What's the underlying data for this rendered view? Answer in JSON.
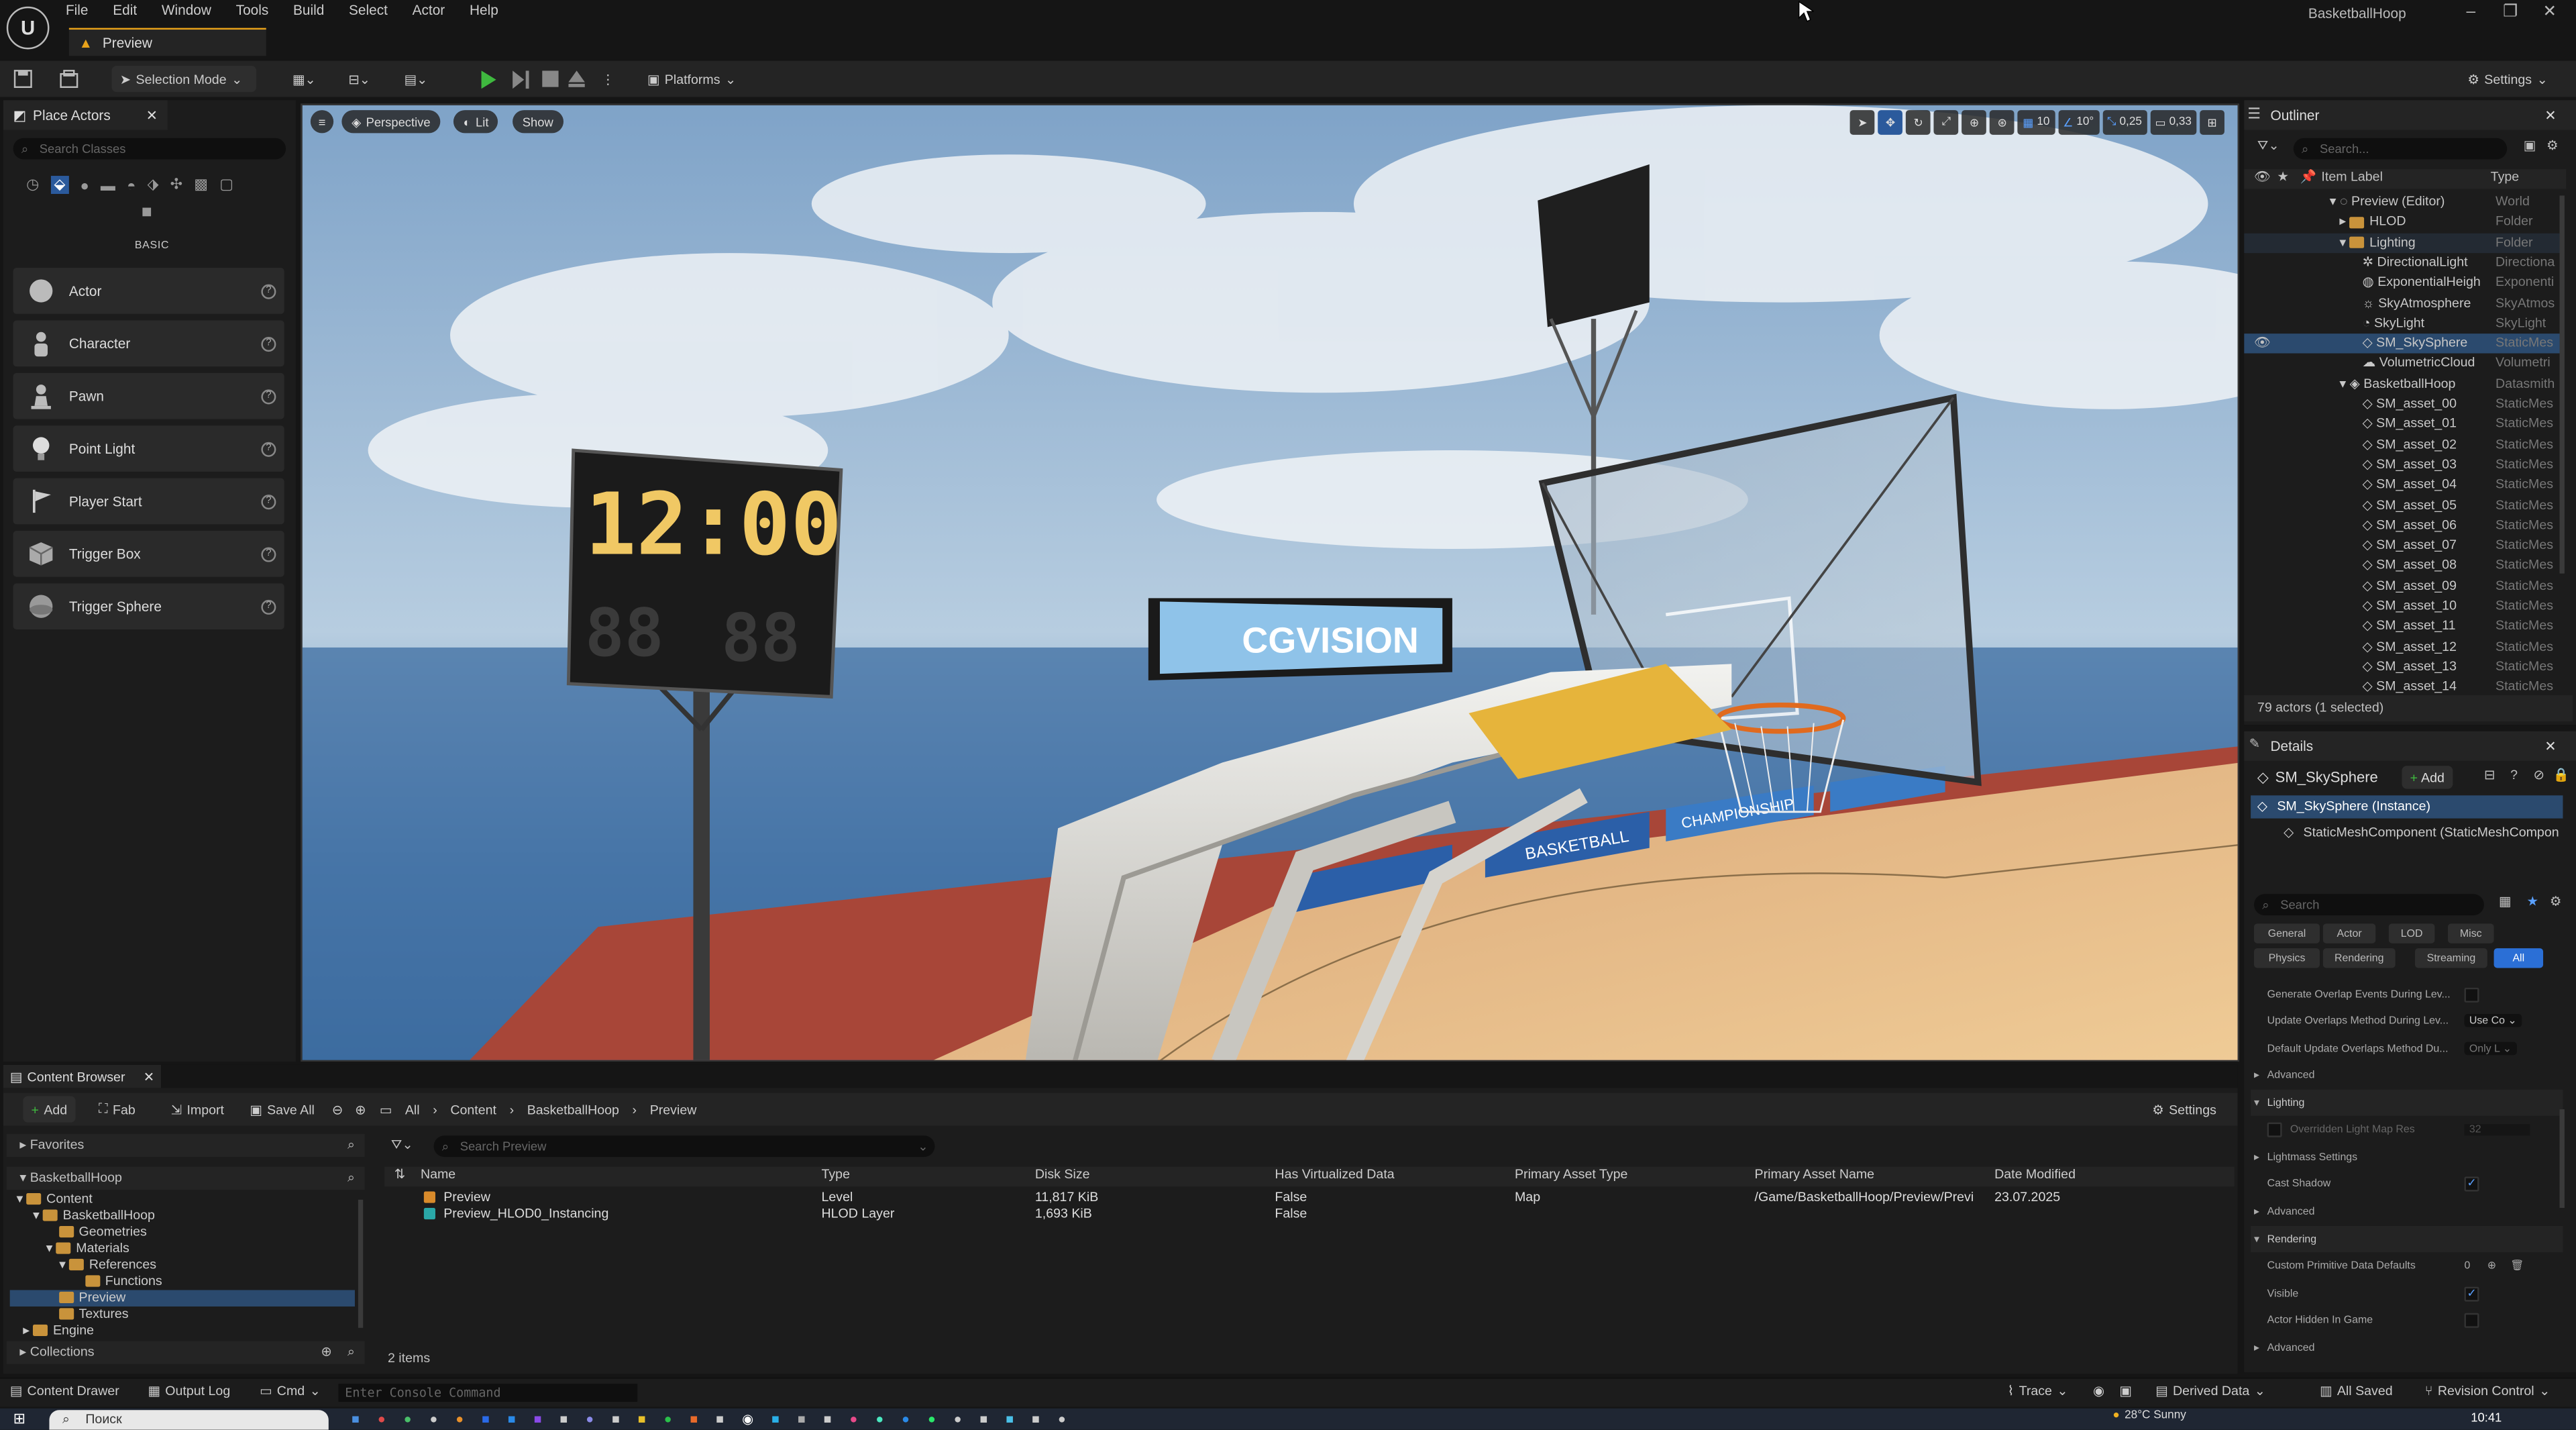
{
  "app": {
    "menu": [
      "File",
      "Edit",
      "Window",
      "Tools",
      "Build",
      "Select",
      "Actor",
      "Help"
    ],
    "doc_tab": "Preview",
    "window_title": "BasketballHoop"
  },
  "toolbar": {
    "selection_mode": "Selection Mode",
    "platforms": "Platforms",
    "settings": "Settings"
  },
  "place_actors": {
    "tab": "Place Actors",
    "search_placeholder": "Search Classes",
    "category": "BASIC",
    "items": [
      "Actor",
      "Character",
      "Pawn",
      "Point Light",
      "Player Start",
      "Trigger Box",
      "Trigger Sphere"
    ]
  },
  "viewport": {
    "perspective": "Perspective",
    "lit": "Lit",
    "show": "Show",
    "grid_snap": "10",
    "rot_snap": "10°",
    "scale_snap": "0,25",
    "cam_speed": "0,33",
    "scoreboard_time": "12:00",
    "scoreboard_score_left": "88",
    "scoreboard_score_right": "88",
    "sign_text": "CGVISION",
    "banner1": "BASKETBALL",
    "banner2": "CHAMPIONSHIP"
  },
  "outliner": {
    "tab": "Outliner",
    "search_placeholder": "Search...",
    "col_label": "Item Label",
    "col_type": "Type",
    "rows": [
      {
        "name": "Preview (Editor)",
        "type": "World"
      },
      {
        "name": "HLOD",
        "type": "Folder"
      },
      {
        "name": "Lighting",
        "type": "Folder"
      },
      {
        "name": "DirectionalLight",
        "type": "Directiona"
      },
      {
        "name": "ExponentialHeigh",
        "type": "Exponenti"
      },
      {
        "name": "SkyAtmosphere",
        "type": "SkyAtmos"
      },
      {
        "name": "SkyLight",
        "type": "SkyLight"
      },
      {
        "name": "SM_SkySphere",
        "type": "StaticMes"
      },
      {
        "name": "VolumetricCloud",
        "type": "Volumetri"
      },
      {
        "name": "BasketballHoop",
        "type": "Datasmith"
      },
      {
        "name": "SM_asset_00",
        "type": "StaticMes"
      },
      {
        "name": "SM_asset_01",
        "type": "StaticMes"
      },
      {
        "name": "SM_asset_02",
        "type": "StaticMes"
      },
      {
        "name": "SM_asset_03",
        "type": "StaticMes"
      },
      {
        "name": "SM_asset_04",
        "type": "StaticMes"
      },
      {
        "name": "SM_asset_05",
        "type": "StaticMes"
      },
      {
        "name": "SM_asset_06",
        "type": "StaticMes"
      },
      {
        "name": "SM_asset_07",
        "type": "StaticMes"
      },
      {
        "name": "SM_asset_08",
        "type": "StaticMes"
      },
      {
        "name": "SM_asset_09",
        "type": "StaticMes"
      },
      {
        "name": "SM_asset_10",
        "type": "StaticMes"
      },
      {
        "name": "SM_asset_11",
        "type": "StaticMes"
      },
      {
        "name": "SM_asset_12",
        "type": "StaticMes"
      },
      {
        "name": "SM_asset_13",
        "type": "StaticMes"
      },
      {
        "name": "SM_asset_14",
        "type": "StaticMes"
      }
    ],
    "status": "79 actors (1 selected)"
  },
  "details": {
    "tab": "Details",
    "actor_name": "SM_SkySphere",
    "add": "Add",
    "instance": "SM_SkySphere (Instance)",
    "component": "StaticMeshComponent (StaticMeshCompon",
    "search_placeholder": "Search",
    "filters_row1": [
      "General",
      "Actor",
      "LOD",
      "Misc"
    ],
    "filters_row2": [
      "Physics",
      "Rendering",
      "Streaming",
      "All"
    ],
    "gen_overlap": "Generate Overlap Events During Lev...",
    "upd_overlap": "Update Overlaps Method During Lev...",
    "upd_overlap_val": "Use Co",
    "def_overlap": "Default Update Overlaps Method Du...",
    "def_overlap_val": "Only L",
    "advanced": "Advanced",
    "lighting": "Lighting",
    "overridden_lm": "Overridden Light Map Res",
    "overridden_lm_val": "32",
    "lightmass": "Lightmass Settings",
    "cast_shadow": "Cast Shadow",
    "rendering": "Rendering",
    "custom_prim": "Custom Primitive Data Defaults",
    "custom_prim_val": "0",
    "visible": "Visible",
    "hidden_in_game": "Actor Hidden In Game"
  },
  "content_browser": {
    "tab": "Content Browser",
    "add": "Add",
    "fab": "Fab",
    "import": "Import",
    "save_all": "Save All",
    "breadcrumb": [
      "All",
      "Content",
      "BasketballHoop",
      "Preview"
    ],
    "settings": "Settings",
    "favorites": "Favorites",
    "root": "BasketballHoop",
    "tree": [
      "Content",
      "BasketballHoop",
      "Geometries",
      "Materials",
      "References",
      "Functions",
      "Preview",
      "Textures",
      "Engine"
    ],
    "collections": "Collections",
    "search_placeholder": "Search Preview",
    "columns": [
      "Name",
      "Type",
      "Disk Size",
      "Has Virtualized Data",
      "Primary Asset Type",
      "Primary Asset Name",
      "Date Modified"
    ],
    "rows": [
      [
        "Preview",
        "Level",
        "11,817 KiB",
        "False",
        "Map",
        "/Game/BasketballHoop/Preview/Previ",
        "23.07.2025"
      ],
      [
        "Preview_HLOD0_Instancing",
        "HLOD Layer",
        "1,693 KiB",
        "False",
        "",
        "",
        ""
      ]
    ],
    "count": "2 items"
  },
  "statusbar": {
    "content_drawer": "Content Drawer",
    "output_log": "Output Log",
    "cmd": "Cmd",
    "console_placeholder": "Enter Console Command",
    "trace": "Trace",
    "derived_data": "Derived Data",
    "all_saved": "All Saved",
    "revision_control": "Revision Control"
  },
  "taskbar": {
    "search": "Поиск",
    "weather": "28°C Sunny",
    "time": "10:41"
  }
}
